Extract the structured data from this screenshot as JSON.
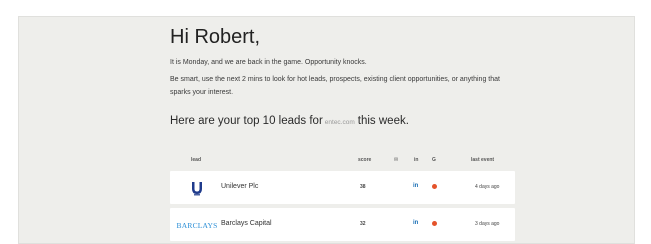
{
  "greeting": "Hi Robert,",
  "intro": "It is Monday, and we are back in the game. Opportunity knocks.",
  "advice": "Be smart, use the next 2 mins to look for hot leads, prospects, existing client opportunities, or anything that sparks your interest.",
  "leads_heading": {
    "prefix": "Here are your top 10 leads for",
    "domain": "entec.com",
    "suffix": "this week."
  },
  "table": {
    "columns": {
      "lead": "lead",
      "score": "score",
      "mail": "✉",
      "in": "in",
      "g": "G",
      "last_event": "last event"
    },
    "rows": [
      {
        "name": "Unilever Plc",
        "score": "38",
        "linkedin": "in",
        "last_event": "4 days ago",
        "logo_icon": "unilever-u-icon",
        "logo_color": "#1f3b8c"
      },
      {
        "name": "Barclays Capital",
        "score": "32",
        "linkedin": "in",
        "last_event": "3 days ago",
        "logo_icon": "barclays-eagle-icon",
        "logo_text": "BARCLAYS",
        "logo_color": "#2a8ed6"
      }
    ]
  },
  "colors": {
    "panel_bg": "#eeeeeb",
    "linkedin": "#1a6fb5",
    "google_dot": "#e4532b"
  }
}
